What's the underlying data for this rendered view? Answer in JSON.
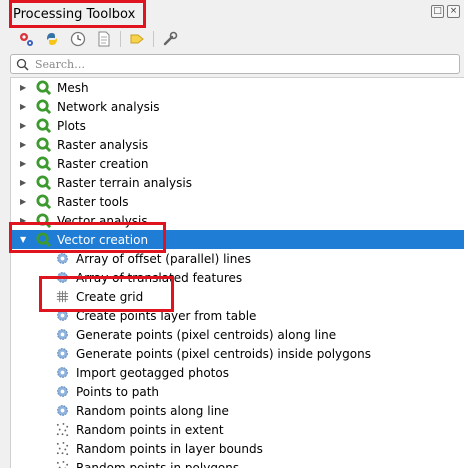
{
  "panel": {
    "title": "Processing Toolbox",
    "window_buttons": [
      "restore",
      "close"
    ]
  },
  "toolbar": {
    "buttons": [
      {
        "name": "models-button",
        "icon": "gear-models-icon"
      },
      {
        "name": "scripts-button",
        "icon": "python-icon"
      },
      {
        "name": "history-button",
        "icon": "clock-icon"
      },
      {
        "name": "results-button",
        "icon": "document-icon"
      },
      {
        "name": "edit-features-button",
        "icon": "pencil-icon"
      },
      {
        "name": "options-button",
        "icon": "wrench-icon"
      }
    ]
  },
  "search": {
    "placeholder": "Search…"
  },
  "tree": {
    "groups": [
      {
        "label": "Mesh",
        "expanded": false
      },
      {
        "label": "Network analysis",
        "expanded": false
      },
      {
        "label": "Plots",
        "expanded": false
      },
      {
        "label": "Raster analysis",
        "expanded": false
      },
      {
        "label": "Raster creation",
        "expanded": false
      },
      {
        "label": "Raster terrain analysis",
        "expanded": false
      },
      {
        "label": "Raster tools",
        "expanded": false
      },
      {
        "label": "Vector analysis",
        "expanded": false
      },
      {
        "label": "Vector creation",
        "expanded": true,
        "selected": true
      }
    ],
    "tools": [
      {
        "label": "Array of offset (parallel) lines",
        "icon": "gear-icon"
      },
      {
        "label": "Array of translated features",
        "icon": "gear-icon"
      },
      {
        "label": "Create grid",
        "icon": "grid-icon"
      },
      {
        "label": "Create points layer from table",
        "icon": "gear-icon"
      },
      {
        "label": "Generate points (pixel centroids) along line",
        "icon": "gear-icon"
      },
      {
        "label": "Generate points (pixel centroids) inside polygons",
        "icon": "gear-icon"
      },
      {
        "label": "Import geotagged photos",
        "icon": "gear-icon"
      },
      {
        "label": "Points to path",
        "icon": "gear-icon"
      },
      {
        "label": "Random points along line",
        "icon": "gear-icon"
      },
      {
        "label": "Random points in extent",
        "icon": "dots-icon"
      },
      {
        "label": "Random points in layer bounds",
        "icon": "dots-icon"
      },
      {
        "label": "Random points in polygons",
        "icon": "dots-icon"
      }
    ]
  },
  "colors": {
    "selection": "#1f7dd6",
    "highlight": "#e0141e",
    "qgis_green": "#3c9a2e"
  }
}
